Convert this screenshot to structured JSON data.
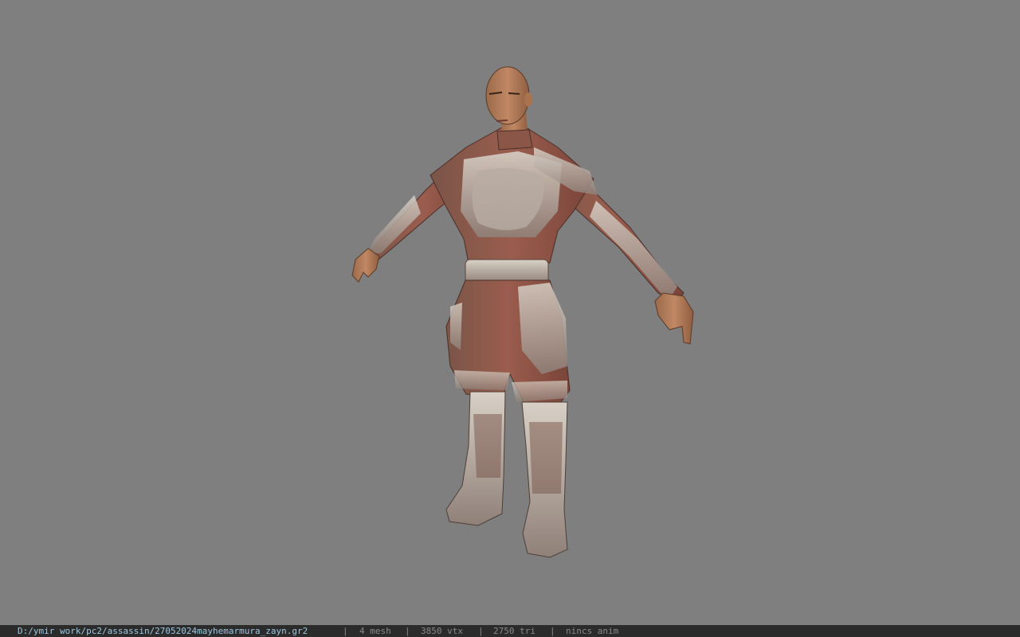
{
  "viewer": {
    "background_color": "#7f7f7f",
    "status_bar_color": "#2b2b2b",
    "path_color": "#9ec8e0",
    "text_color": "#8a8a8a"
  },
  "status_bar": {
    "file_path": "D:/ymir work/pc2/assassin/27052024mayhemarmura_zayn.gr2",
    "separator": "|",
    "mesh": "4 mesh",
    "vertices": "3850 vtx",
    "triangles": "2750 tri",
    "animation": "nincs anim"
  }
}
